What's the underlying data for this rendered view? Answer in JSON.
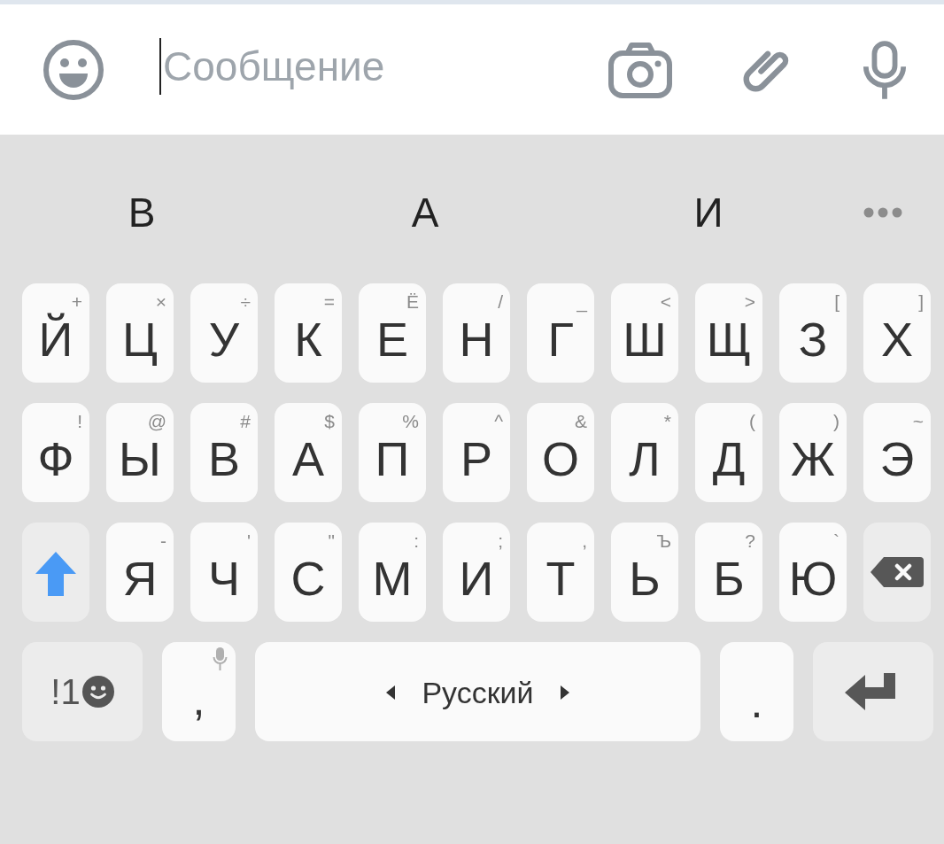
{
  "input_bar": {
    "placeholder": "Сообщение"
  },
  "suggestions": [
    {
      "text": "В"
    },
    {
      "text": "А"
    },
    {
      "text": "И"
    }
  ],
  "keyboard": {
    "rows": [
      {
        "keys": [
          {
            "kind": "letter",
            "label": "Й",
            "hint": "+"
          },
          {
            "kind": "letter",
            "label": "Ц",
            "hint": "×"
          },
          {
            "kind": "letter",
            "label": "У",
            "hint": "÷"
          },
          {
            "kind": "letter",
            "label": "К",
            "hint": "="
          },
          {
            "kind": "letter",
            "label": "Е",
            "hint": "Ё"
          },
          {
            "kind": "letter",
            "label": "Н",
            "hint": "/"
          },
          {
            "kind": "letter",
            "label": "Г",
            "hint": "_"
          },
          {
            "kind": "letter",
            "label": "Ш",
            "hint": "<"
          },
          {
            "kind": "letter",
            "label": "Щ",
            "hint": ">"
          },
          {
            "kind": "letter",
            "label": "З",
            "hint": "["
          },
          {
            "kind": "letter",
            "label": "Х",
            "hint": "]"
          }
        ]
      },
      {
        "keys": [
          {
            "kind": "letter",
            "label": "Ф",
            "hint": "!"
          },
          {
            "kind": "letter",
            "label": "Ы",
            "hint": "@"
          },
          {
            "kind": "letter",
            "label": "В",
            "hint": "#"
          },
          {
            "kind": "letter",
            "label": "А",
            "hint": "$"
          },
          {
            "kind": "letter",
            "label": "П",
            "hint": "%"
          },
          {
            "kind": "letter",
            "label": "Р",
            "hint": "^"
          },
          {
            "kind": "letter",
            "label": "О",
            "hint": "&"
          },
          {
            "kind": "letter",
            "label": "Л",
            "hint": "*"
          },
          {
            "kind": "letter",
            "label": "Д",
            "hint": "("
          },
          {
            "kind": "letter",
            "label": "Ж",
            "hint": ")"
          },
          {
            "kind": "letter",
            "label": "Э",
            "hint": "~"
          }
        ]
      },
      {
        "keys": [
          {
            "kind": "shift",
            "on": true
          },
          {
            "kind": "letter",
            "label": "Я",
            "hint": "-"
          },
          {
            "kind": "letter",
            "label": "Ч",
            "hint": "'"
          },
          {
            "kind": "letter",
            "label": "С",
            "hint": "\""
          },
          {
            "kind": "letter",
            "label": "М",
            "hint": ":"
          },
          {
            "kind": "letter",
            "label": "И",
            "hint": ";"
          },
          {
            "kind": "letter",
            "label": "Т",
            "hint": ","
          },
          {
            "kind": "letter",
            "label": "Ь",
            "hint": "Ъ"
          },
          {
            "kind": "letter",
            "label": "Б",
            "hint": "?"
          },
          {
            "kind": "letter",
            "label": "Ю",
            "hint": "`"
          },
          {
            "kind": "backspace"
          }
        ]
      },
      {
        "keys": [
          {
            "kind": "mode",
            "label": "!1"
          },
          {
            "kind": "comma",
            "label": ","
          },
          {
            "kind": "space",
            "label": "Русский"
          },
          {
            "kind": "period",
            "label": "."
          },
          {
            "kind": "enter"
          }
        ]
      }
    ]
  }
}
